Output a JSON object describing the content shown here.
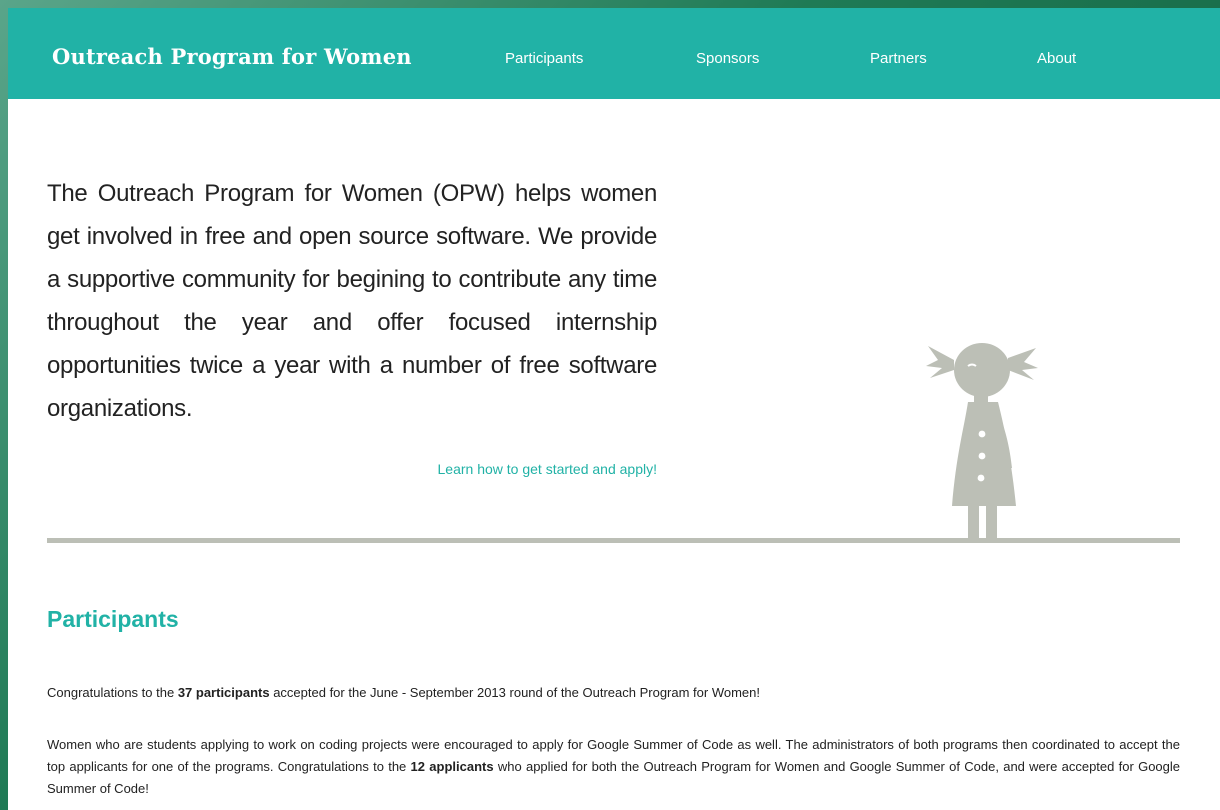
{
  "nav": {
    "brand": "Outreach Program for Women",
    "links": [
      "Participants",
      "Sponsors",
      "Partners",
      "About"
    ]
  },
  "intro": {
    "text": "The Outreach Program for Women (OPW) helps women get involved in free and open source software. We provide a supportive community for begining to contribute any time throughout the year and offer focused internship opportunities twice a year with a number of free software organizations.",
    "cta": "Learn how to get started and apply!"
  },
  "participants": {
    "heading": "Participants",
    "p1_before": "Congratulations to the ",
    "p1_bold": "37 participants",
    "p1_after": " accepted for the June - September 2013 round of the Outreach Program for Women!",
    "p2_before": "Women who are students applying to work on coding projects were encouraged to apply for Google Summer of Code as well. The administrators of both programs then coordinated to accept the top applicants for one of the programs. Congratulations to the ",
    "p2_bold": "12 applicants",
    "p2_after": " who applied for both the Outreach Program for Women and Google Summer of Code, and were accepted for Google Summer of Code!"
  },
  "colors": {
    "accent": "#21b2a6",
    "divider": "#bcbfb6",
    "illustration": "#bcbfb6",
    "text": "#222222"
  },
  "icons": {
    "illustration": "girl-silhouette-icon"
  }
}
